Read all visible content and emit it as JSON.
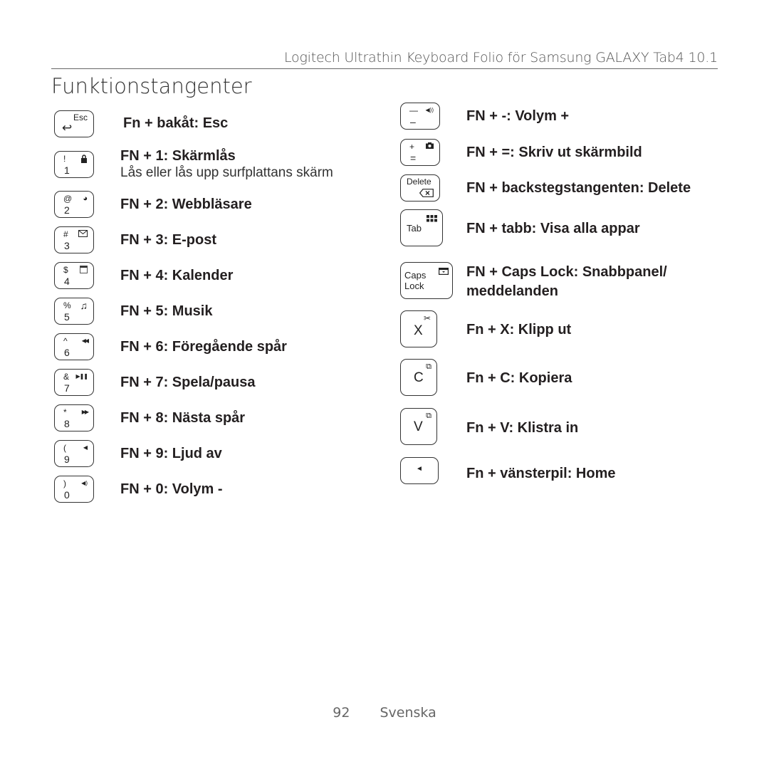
{
  "header": {
    "product": "Logitech Ultrathin Keyboard Folio för Samsung GALAXY Tab4 10.1"
  },
  "page_title": "Funktionstangenter",
  "left_column": [
    {
      "key_top": "Esc",
      "key_icon": "back-arrow",
      "key_icon_glyph": "↩",
      "label": "Fn + bakåt: Esc"
    },
    {
      "key_sym": "!",
      "key_num": "1",
      "key_icon": "lock",
      "key_icon_glyph": "🔒",
      "label": "FN + 1: Skärmlås",
      "sublabel": "Lås eller lås upp surfplattans skärm"
    },
    {
      "key_sym": "@",
      "key_num": "2",
      "key_icon": "globe",
      "key_icon_glyph": "◕",
      "label": "FN + 2: Webbläsare"
    },
    {
      "key_sym": "#",
      "key_num": "3",
      "key_icon": "envelope",
      "key_icon_glyph": "✉",
      "label": "FN + 3: E-post"
    },
    {
      "key_sym": "$",
      "key_num": "4",
      "key_icon": "calendar",
      "key_icon_glyph": "▤",
      "label": "FN + 4: Kalender"
    },
    {
      "key_sym": "%",
      "key_num": "5",
      "key_icon": "music-note",
      "key_icon_glyph": "♫",
      "label": "FN + 5: Musik"
    },
    {
      "key_sym": "^",
      "key_num": "6",
      "key_icon": "previous-track",
      "key_icon_glyph": "◀◀",
      "label": "FN + 6: Föregående spår"
    },
    {
      "key_sym": "&",
      "key_num": "7",
      "key_icon": "play-pause",
      "key_icon_glyph": "▶❚❚",
      "label": "FN + 7: Spela/pausa"
    },
    {
      "key_sym": "*",
      "key_num": "8",
      "key_icon": "next-track",
      "key_icon_glyph": "▶▶",
      "label": "FN + 8: Nästa spår"
    },
    {
      "key_sym": "(",
      "key_num": "9",
      "key_icon": "mute",
      "key_icon_glyph": "◀",
      "label": "FN + 9: Ljud av"
    },
    {
      "key_sym": ")",
      "key_num": "0",
      "key_icon": "volume-down",
      "key_icon_glyph": "◀)",
      "label": "FN + 0: Volym -"
    }
  ],
  "right_column": [
    {
      "key_sym": "—",
      "key_num": "–",
      "key_icon": "volume-up",
      "key_icon_glyph": "◀))",
      "label": "FN + -: Volym +"
    },
    {
      "key_sym": "+",
      "key_num": "=",
      "key_icon": "camera",
      "key_icon_glyph": "◘",
      "label": "FN + =: Skriv ut skärmbild"
    },
    {
      "key_top": "Delete",
      "key_icon": "backspace",
      "key_icon_glyph": "⌫",
      "label": "FN + backstegstangenten: Delete"
    },
    {
      "key_text": "Tab",
      "key_icon": "app-grid",
      "key_icon_glyph": "▪▪▪",
      "label": "FN + tabb: Visa alla appar"
    },
    {
      "key_text": "Caps\nLock",
      "key_icon": "notification-panel",
      "key_icon_glyph": "⊟",
      "label": "FN + Caps Lock: Snabbpanel/",
      "label_line2": "meddelanden"
    },
    {
      "key_text": "X",
      "key_icon": "scissors",
      "key_icon_glyph": "✂",
      "label": "Fn + X: Klipp ut"
    },
    {
      "key_text": "C",
      "key_icon": "copy",
      "key_icon_glyph": "⧉",
      "label": "Fn + C: Kopiera"
    },
    {
      "key_text": "V",
      "key_icon": "paste",
      "key_icon_glyph": "⧉",
      "label": "Fn + V: Klistra in"
    },
    {
      "key_text": "◄",
      "key_icon": "left-arrow",
      "label": "Fn + vänsterpil: Home"
    }
  ],
  "footer": {
    "page_number": "92",
    "language": "Svenska"
  }
}
